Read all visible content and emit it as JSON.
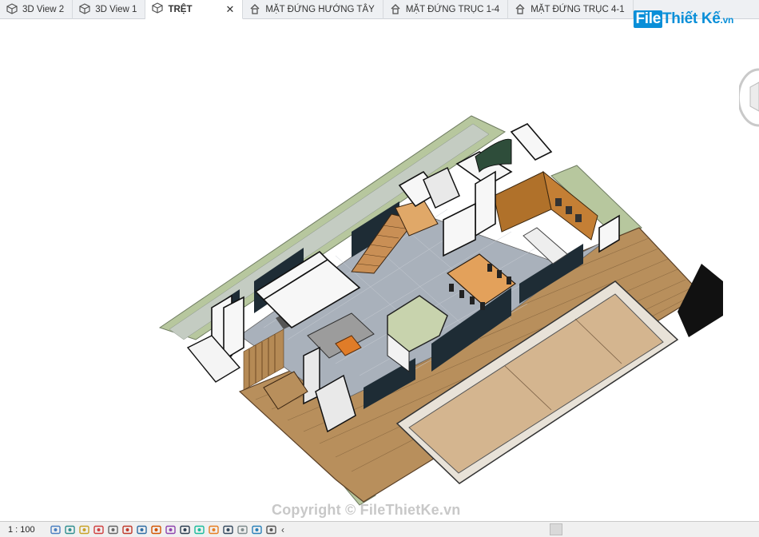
{
  "tabs": [
    {
      "label": "3D View 2",
      "icon": "3d-view-icon",
      "active": false
    },
    {
      "label": "3D View 1",
      "icon": "3d-view-icon",
      "active": false
    },
    {
      "label": "TRỆT",
      "icon": "3d-view-icon",
      "active": true
    },
    {
      "label": "MẶT ĐỨNG HƯỚNG TÂY",
      "icon": "elevation-house-icon",
      "active": false
    },
    {
      "label": "MẶT ĐỨNG TRỤC 1-4",
      "icon": "elevation-house-icon",
      "active": false
    },
    {
      "label": "MẶT ĐỨNG TRỤC 4-1",
      "icon": "elevation-house-icon",
      "active": false
    }
  ],
  "close_glyph": "✕",
  "logo": {
    "part1": "File",
    "part2": "Thiết Kế",
    "part3": ".vn"
  },
  "watermark": "Copyright © FileThietKe.vn",
  "status": {
    "scale": "1 : 100",
    "icons": [
      "detail-level-icon",
      "visual-style-icon",
      "sun-path-icon",
      "shadows-icon",
      "crop-view-icon",
      "show-crop-icon",
      "unlock-3d-icon",
      "temporary-hide-icon",
      "reveal-hidden-icon",
      "analytical-model-icon",
      "highlight-displacement-icon",
      "constraints-icon",
      "render-icon",
      "worksharing-icon",
      "design-options-icon",
      "view-properties-icon"
    ],
    "chevron": "‹"
  },
  "colors": {
    "wood": "#b88f5c",
    "floor": "#a9b1bb",
    "lawn": "#b7c79e",
    "pool": "#d4b58f",
    "dark": "#1a1a1a"
  }
}
